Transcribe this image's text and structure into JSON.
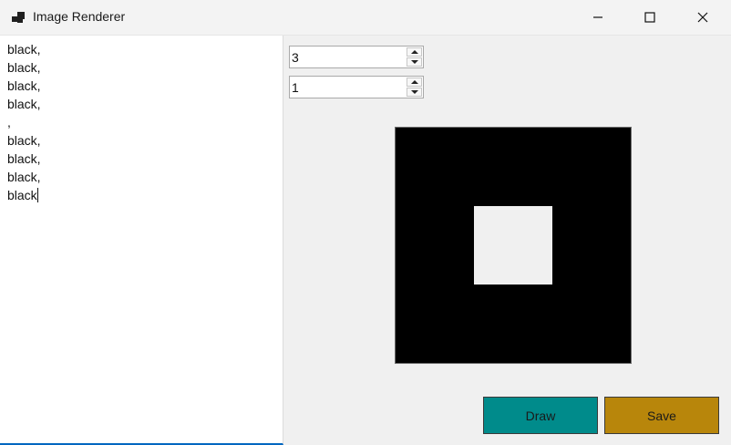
{
  "window": {
    "title": "Image Renderer"
  },
  "editor": {
    "lines": [
      "black,",
      "black,",
      "black,",
      "black,",
      ",",
      "black,",
      "black,",
      "black,",
      "black"
    ]
  },
  "controls": {
    "size_value": "3",
    "thickness_value": "1",
    "draw_label": "Draw",
    "save_label": "Save"
  },
  "colors": {
    "draw_button": "#008b8b",
    "save_button": "#b8860b",
    "canvas_fill": "#000000"
  },
  "icons": {
    "app": "app-icon",
    "minimize": "minimize-icon",
    "maximize": "maximize-icon",
    "close": "close-icon",
    "spin_up": "spin-up-arrow-icon",
    "spin_down": "spin-down-arrow-icon"
  }
}
